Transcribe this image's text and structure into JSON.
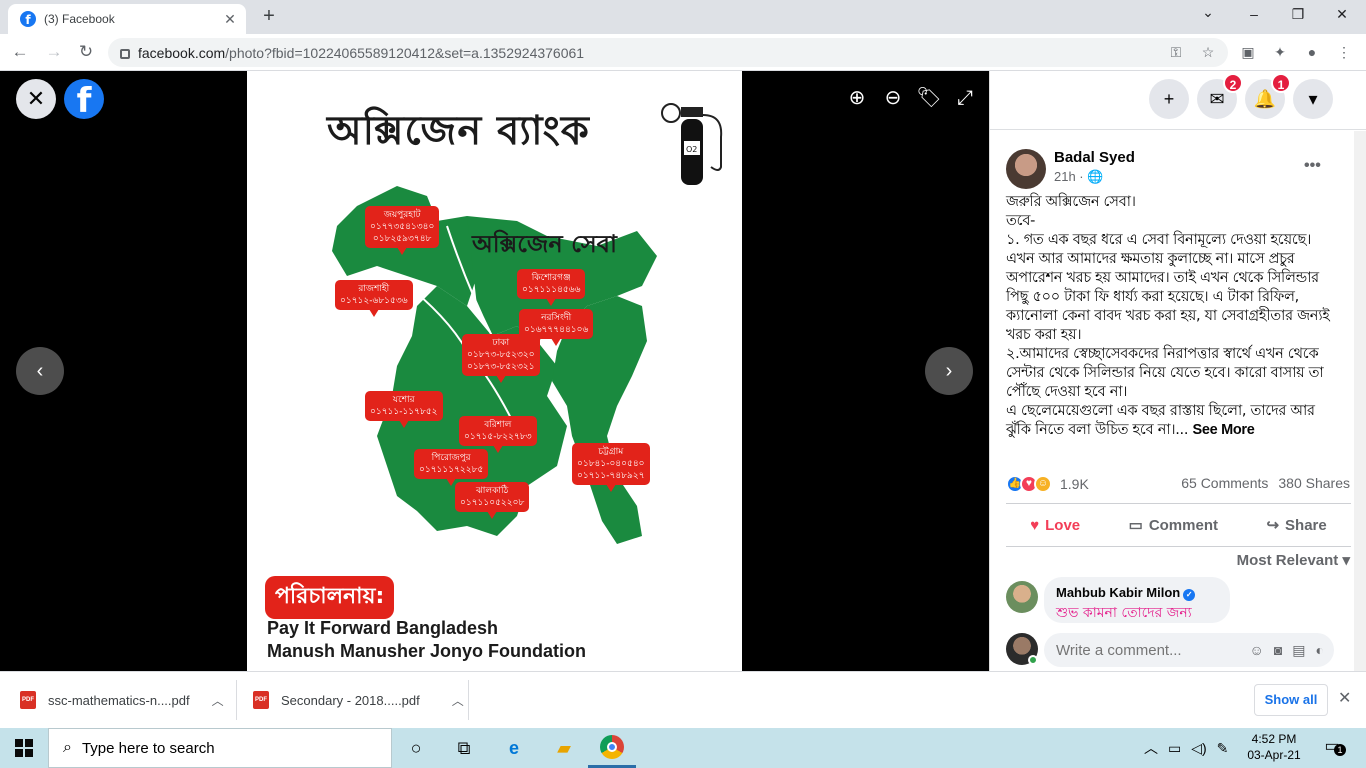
{
  "browser": {
    "tab_title": "(3) Facebook",
    "new_tab": "+",
    "url_host": "facebook.com",
    "url_path": "/photo?fbid=10224065589120412&set=a.1352924376061",
    "window_buttons": {
      "minimize": "–",
      "maximize": "❐",
      "close": "✕"
    }
  },
  "viewer": {
    "close": "✕",
    "logo": "f",
    "tools": [
      "zoom-in",
      "zoom-out",
      "tag",
      "fullscreen"
    ],
    "prev": "‹",
    "next": "›"
  },
  "poster": {
    "title": "অক্সিজেন ব্যাংক",
    "subtitle": "অক্সিজেন সেবা",
    "pins": [
      {
        "area": "জয়পুরহাট",
        "phones": "০১৭৭৩৫৪১৩৪০\n০১৮২৫৯৩৭৪৮"
      },
      {
        "area": "রাজশাহী",
        "phones": "০১৭১২-৬৮১৫৩৬"
      },
      {
        "area": "কিশোরগঞ্জ",
        "phones": "০১৭১১১৪৫৬৬"
      },
      {
        "area": "নরসিংদী",
        "phones": "০১৬৭৭৭৪৪১০৬"
      },
      {
        "area": "ঢাকা",
        "phones": "০১৮৭৩-৮৫২৩২০\n০১৮৭৩-৮৫২৩২১"
      },
      {
        "area": "যশোর",
        "phones": "০১৭১১-১১৭৮৫২"
      },
      {
        "area": "বরিশাল",
        "phones": "০১৭১৫-৮২২৭৮৩"
      },
      {
        "area": "পিরোজপুর",
        "phones": "০১৭১১১৭২২৮৫"
      },
      {
        "area": "ঝালকাঠি",
        "phones": "০১৭১১০৫২২০৮"
      },
      {
        "area": "চট্টগ্রাম",
        "phones": "০১৮৪১-০৪০৫৪০\n০১৭১১-৭৪৮৯২৭"
      }
    ],
    "managed_by": "পরিচালনায়:",
    "org1": "Pay It Forward Bangladesh",
    "org2": "Manush Manusher Jonyo Foundation"
  },
  "header_right": {
    "create": "+",
    "messenger_badge": "2",
    "notifications_badge": "1",
    "menu": "▾"
  },
  "post": {
    "author": "Badal Syed",
    "time": "21h · 🌐",
    "more": "•••",
    "text": "জরুরি অক্সিজেন সেবা।\nতবে-\n১. গত এক বছর ধরে এ সেবা বিনামূল্যে দেওয়া হয়েছে। এখন আর আমাদের ক্ষমতায় কুলাচ্ছে না। মাসে প্রচুর অপারেশন খরচ হয় আমাদের। তাই এখন থেকে সিলিন্ডার পিছু ৫০০ টাকা ফি ধার্য্য করা হয়েছে। এ টাকা রিফিল, ক্যানোলা কেনা বাবদ খরচ করা হয়, যা সেবাগ্রহীতার জন্যই খরচ করা হয়।\n২.আমাদের স্বেচ্ছাসেবকদের নিরাপত্তার স্বার্থে এখন থেকে সেন্টার থেকে সিলিন্ডার নিয়ে যেতে হবে। কারো বাসায় তা পৌঁছে দেওয়া হবে না।\nএ ছেলেমেয়েগুলো এক বছর রাস্তায় ছিলো, তাদের আর ঝুঁকি নিতে বলা উচিত হবে না।... ",
    "see_more": "See More",
    "reaction_count": "1.9K",
    "comments": "65 Comments",
    "shares": "380 Shares",
    "actions": {
      "love": "Love",
      "comment": "Comment",
      "share": "Share"
    },
    "sort": "Most Relevant ▾"
  },
  "comment": {
    "name": "Mahbub Kabir Milon",
    "text": "শুভ কামনা তোদের জন্য",
    "input_placeholder": "Write a comment..."
  },
  "downloads": {
    "items": [
      "ssc-mathematics-n....pdf",
      "Secondary - 2018.....pdf"
    ],
    "show_all": "Show all"
  },
  "taskbar": {
    "search_placeholder": "Type here to search",
    "time": "4:52 PM",
    "date": "03-Apr-21",
    "notif_count": "1"
  },
  "colors": {
    "facebook_blue": "#1877f2",
    "map_green": "#1a8a3f",
    "pin_red": "#e2231a",
    "love_red": "#f33e58"
  }
}
